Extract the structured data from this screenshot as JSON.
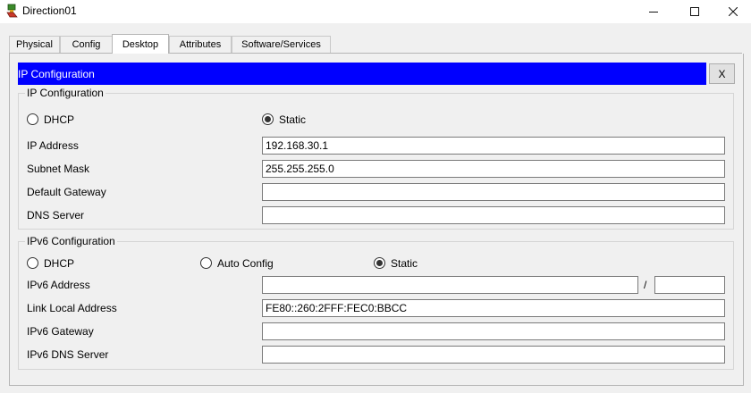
{
  "window": {
    "title": "Direction01",
    "controls": {
      "minimize_icon": "minimize-icon",
      "maximize_icon": "maximize-icon",
      "close_icon": "close-icon"
    }
  },
  "tabs": [
    {
      "label": "Physical",
      "active": false
    },
    {
      "label": "Config",
      "active": false
    },
    {
      "label": "Desktop",
      "active": true
    },
    {
      "label": "Attributes",
      "active": false
    },
    {
      "label": "Software/Services",
      "active": false
    }
  ],
  "panel": {
    "title": "IP Configuration",
    "close_label": "X"
  },
  "ipv4": {
    "legend": "IP Configuration",
    "dhcp_label": "DHCP",
    "static_label": "Static",
    "mode": "Static",
    "ip_address_label": "IP Address",
    "ip_address": "192.168.30.1",
    "subnet_mask_label": "Subnet Mask",
    "subnet_mask": "255.255.255.0",
    "gateway_label": "Default Gateway",
    "gateway": "",
    "dns_label": "DNS Server",
    "dns": ""
  },
  "ipv6": {
    "legend": "IPv6 Configuration",
    "dhcp_label": "DHCP",
    "auto_label": "Auto Config",
    "static_label": "Static",
    "mode": "Static",
    "address_label": "IPv6 Address",
    "address": "",
    "slash": "/",
    "prefix": "",
    "link_local_label": "Link Local Address",
    "link_local": "FE80::260:2FFF:FEC0:BBCC",
    "gateway_label": "IPv6 Gateway",
    "gateway": "",
    "dns_label": "IPv6 DNS Server",
    "dns": ""
  },
  "colors": {
    "accent_bar": "#0000ff",
    "background": "#f0f0f0"
  }
}
